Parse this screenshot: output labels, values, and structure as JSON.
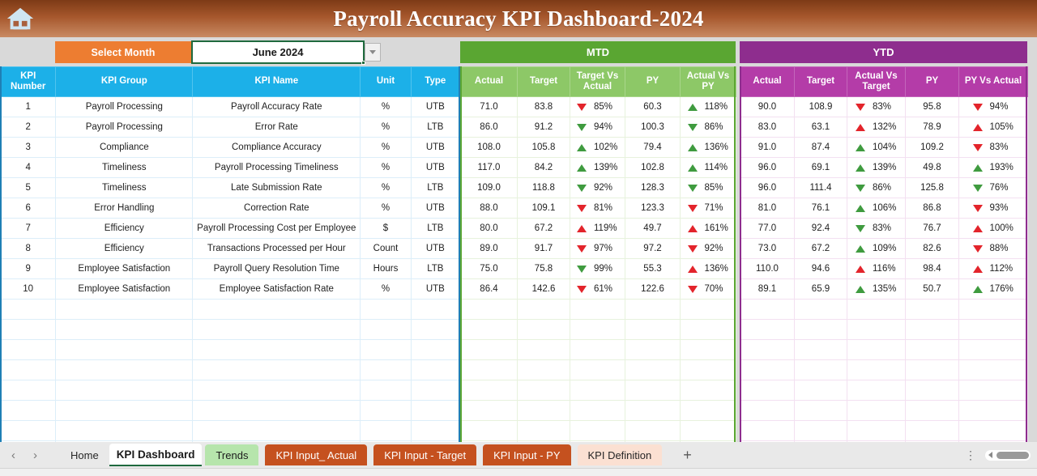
{
  "banner": {
    "title": "Payroll Accuracy KPI Dashboard-2024",
    "home_icon": "home-icon"
  },
  "controls": {
    "select_month_label": "Select Month",
    "selected_month": "June 2024",
    "dropdown_icon": "chevron-down-icon",
    "mtd_band": "MTD",
    "ytd_band": "YTD"
  },
  "colors": {
    "banner_start": "#7d3a16",
    "banner_end": "#c98a63",
    "orange_accent": "#ed7d31",
    "blue_header": "#1cb0e8",
    "green_header": "#8dc867",
    "green_band": "#5aa632",
    "purple_header": "#b43ca8",
    "purple_band": "#8e2d8e",
    "up_good": "#3f9b3f",
    "down_bad": "#e3242b",
    "active_tab_underline": "#1f6a3e"
  },
  "table": {
    "left_headers": [
      "KPI Number",
      "KPI Group",
      "KPI Name",
      "Unit",
      "Type"
    ],
    "mtd_headers": [
      "Actual",
      "Target",
      "Target Vs Actual",
      "PY",
      "Actual Vs PY"
    ],
    "ytd_headers": [
      "Actual",
      "Target",
      "Actual Vs Target",
      "PY",
      "PY Vs Actual"
    ],
    "rows": [
      {
        "kpi_number": "1",
        "kpi_group": "Payroll Processing",
        "kpi_name": "Payroll Accuracy Rate",
        "unit": "%",
        "type": "UTB",
        "mtd": {
          "actual": "71.0",
          "target": "83.8",
          "target_vs_actual": "85%",
          "tva_dir": "down",
          "tva_color": "red",
          "py": "60.3",
          "actual_vs_py": "118%",
          "avp_dir": "up",
          "avp_color": "green"
        },
        "ytd": {
          "actual": "90.0",
          "target": "108.9",
          "actual_vs_target": "83%",
          "avt_dir": "down",
          "avt_color": "red",
          "py": "95.8",
          "py_vs_actual": "94%",
          "pva_dir": "down",
          "pva_color": "red"
        }
      },
      {
        "kpi_number": "2",
        "kpi_group": "Payroll Processing",
        "kpi_name": "Error Rate",
        "unit": "%",
        "type": "LTB",
        "mtd": {
          "actual": "86.0",
          "target": "91.2",
          "target_vs_actual": "94%",
          "tva_dir": "down",
          "tva_color": "green",
          "py": "100.3",
          "actual_vs_py": "86%",
          "avp_dir": "down",
          "avp_color": "green"
        },
        "ytd": {
          "actual": "83.0",
          "target": "63.1",
          "actual_vs_target": "132%",
          "avt_dir": "up",
          "avt_color": "red",
          "py": "78.9",
          "py_vs_actual": "105%",
          "pva_dir": "up",
          "pva_color": "red"
        }
      },
      {
        "kpi_number": "3",
        "kpi_group": "Compliance",
        "kpi_name": "Compliance Accuracy",
        "unit": "%",
        "type": "UTB",
        "mtd": {
          "actual": "108.0",
          "target": "105.8",
          "target_vs_actual": "102%",
          "tva_dir": "up",
          "tva_color": "green",
          "py": "79.4",
          "actual_vs_py": "136%",
          "avp_dir": "up",
          "avp_color": "green"
        },
        "ytd": {
          "actual": "91.0",
          "target": "87.4",
          "actual_vs_target": "104%",
          "avt_dir": "up",
          "avt_color": "green",
          "py": "109.2",
          "py_vs_actual": "83%",
          "pva_dir": "down",
          "pva_color": "red"
        }
      },
      {
        "kpi_number": "4",
        "kpi_group": "Timeliness",
        "kpi_name": "Payroll Processing Timeliness",
        "unit": "%",
        "type": "UTB",
        "mtd": {
          "actual": "117.0",
          "target": "84.2",
          "target_vs_actual": "139%",
          "tva_dir": "up",
          "tva_color": "green",
          "py": "102.8",
          "actual_vs_py": "114%",
          "avp_dir": "up",
          "avp_color": "green"
        },
        "ytd": {
          "actual": "96.0",
          "target": "69.1",
          "actual_vs_target": "139%",
          "avt_dir": "up",
          "avt_color": "green",
          "py": "49.8",
          "py_vs_actual": "193%",
          "pva_dir": "up",
          "pva_color": "green"
        }
      },
      {
        "kpi_number": "5",
        "kpi_group": "Timeliness",
        "kpi_name": "Late Submission Rate",
        "unit": "%",
        "type": "LTB",
        "mtd": {
          "actual": "109.0",
          "target": "118.8",
          "target_vs_actual": "92%",
          "tva_dir": "down",
          "tva_color": "green",
          "py": "128.3",
          "actual_vs_py": "85%",
          "avp_dir": "down",
          "avp_color": "green"
        },
        "ytd": {
          "actual": "96.0",
          "target": "111.4",
          "actual_vs_target": "86%",
          "avt_dir": "down",
          "avt_color": "green",
          "py": "125.8",
          "py_vs_actual": "76%",
          "pva_dir": "down",
          "pva_color": "green"
        }
      },
      {
        "kpi_number": "6",
        "kpi_group": "Error Handling",
        "kpi_name": "Correction Rate",
        "unit": "%",
        "type": "UTB",
        "mtd": {
          "actual": "88.0",
          "target": "109.1",
          "target_vs_actual": "81%",
          "tva_dir": "down",
          "tva_color": "red",
          "py": "123.3",
          "actual_vs_py": "71%",
          "avp_dir": "down",
          "avp_color": "red"
        },
        "ytd": {
          "actual": "81.0",
          "target": "76.1",
          "actual_vs_target": "106%",
          "avt_dir": "up",
          "avt_color": "green",
          "py": "86.8",
          "py_vs_actual": "93%",
          "pva_dir": "down",
          "pva_color": "red"
        }
      },
      {
        "kpi_number": "7",
        "kpi_group": "Efficiency",
        "kpi_name": "Payroll Processing Cost per Employee",
        "unit": "$",
        "type": "LTB",
        "mtd": {
          "actual": "80.0",
          "target": "67.2",
          "target_vs_actual": "119%",
          "tva_dir": "up",
          "tva_color": "red",
          "py": "49.7",
          "actual_vs_py": "161%",
          "avp_dir": "up",
          "avp_color": "red"
        },
        "ytd": {
          "actual": "77.0",
          "target": "92.4",
          "actual_vs_target": "83%",
          "avt_dir": "down",
          "avt_color": "green",
          "py": "76.7",
          "py_vs_actual": "100%",
          "pva_dir": "up",
          "pva_color": "red"
        }
      },
      {
        "kpi_number": "8",
        "kpi_group": "Efficiency",
        "kpi_name": "Transactions Processed per Hour",
        "unit": "Count",
        "type": "UTB",
        "mtd": {
          "actual": "89.0",
          "target": "91.7",
          "target_vs_actual": "97%",
          "tva_dir": "down",
          "tva_color": "red",
          "py": "97.2",
          "actual_vs_py": "92%",
          "avp_dir": "down",
          "avp_color": "red"
        },
        "ytd": {
          "actual": "73.0",
          "target": "67.2",
          "actual_vs_target": "109%",
          "avt_dir": "up",
          "avt_color": "green",
          "py": "82.6",
          "py_vs_actual": "88%",
          "pva_dir": "down",
          "pva_color": "red"
        }
      },
      {
        "kpi_number": "9",
        "kpi_group": "Employee Satisfaction",
        "kpi_name": "Payroll Query Resolution Time",
        "unit": "Hours",
        "type": "LTB",
        "mtd": {
          "actual": "75.0",
          "target": "75.8",
          "target_vs_actual": "99%",
          "tva_dir": "down",
          "tva_color": "green",
          "py": "55.3",
          "actual_vs_py": "136%",
          "avp_dir": "up",
          "avp_color": "red"
        },
        "ytd": {
          "actual": "110.0",
          "target": "94.6",
          "actual_vs_target": "116%",
          "avt_dir": "up",
          "avt_color": "red",
          "py": "98.4",
          "py_vs_actual": "112%",
          "pva_dir": "up",
          "pva_color": "red"
        }
      },
      {
        "kpi_number": "10",
        "kpi_group": "Employee Satisfaction",
        "kpi_name": "Employee Satisfaction Rate",
        "unit": "%",
        "type": "UTB",
        "mtd": {
          "actual": "86.4",
          "target": "142.6",
          "target_vs_actual": "61%",
          "tva_dir": "down",
          "tva_color": "red",
          "py": "122.6",
          "actual_vs_py": "70%",
          "avp_dir": "down",
          "avp_color": "red"
        },
        "ytd": {
          "actual": "89.1",
          "target": "65.9",
          "actual_vs_target": "135%",
          "avt_dir": "up",
          "avt_color": "green",
          "py": "50.7",
          "py_vs_actual": "176%",
          "pva_dir": "up",
          "pva_color": "green"
        }
      }
    ],
    "empty_row_count": 8
  },
  "sheet_tabs": {
    "prev_icon": "chevron-left-icon",
    "next_icon": "chevron-right-icon",
    "items": [
      {
        "label": "Home",
        "style": "plain"
      },
      {
        "label": "KPI Dashboard",
        "style": "active"
      },
      {
        "label": "Trends",
        "style": "green"
      },
      {
        "label": "KPI Input_ Actual",
        "style": "orange"
      },
      {
        "label": "KPI Input - Target",
        "style": "orange"
      },
      {
        "label": "KPI Input - PY",
        "style": "orange"
      },
      {
        "label": "KPI Definition",
        "style": "peach"
      }
    ],
    "add_sheet_icon": "plus-icon",
    "kebab_icon": "more-options-icon",
    "hscroll_icon": "horizontal-scrollbar"
  }
}
